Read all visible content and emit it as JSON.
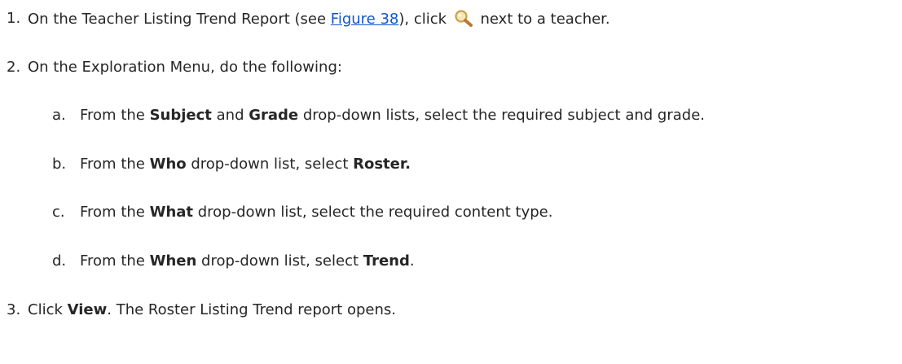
{
  "steps": [
    {
      "num": "1.",
      "pre": "On the Teacher Listing Trend Report (see ",
      "link": "Figure 38",
      "mid": "), click ",
      "icon": "magnifier-icon",
      "post": " next to a teacher."
    },
    {
      "num": "2.",
      "text": "On the Exploration Menu, do the following:"
    },
    {
      "num": "3.",
      "pre": "Click ",
      "bold": "View",
      "post": ". The Roster Listing Trend report opens."
    }
  ],
  "substeps": [
    {
      "letter": "a.",
      "t1": "From the ",
      "b1": "Subject",
      "t2": " and ",
      "b2": "Grade",
      "t3": " drop-down lists, select the required subject and grade."
    },
    {
      "letter": "b.",
      "t1": "From the ",
      "b1": "Who",
      "t2": " drop-down list, select ",
      "b2": "Roster."
    },
    {
      "letter": "c.",
      "t1": "From the ",
      "b1": "What",
      "t2": " drop-down list, select the required content type."
    },
    {
      "letter": "d.",
      "t1": "From the ",
      "b1": "When",
      "t2": " drop-down list, select ",
      "b2": "Trend",
      "t3": "."
    }
  ],
  "colors": {
    "text": "#262626",
    "link": "#1155cc",
    "icon_lens": "#c8a24a",
    "icon_handle": "#b9782e"
  }
}
